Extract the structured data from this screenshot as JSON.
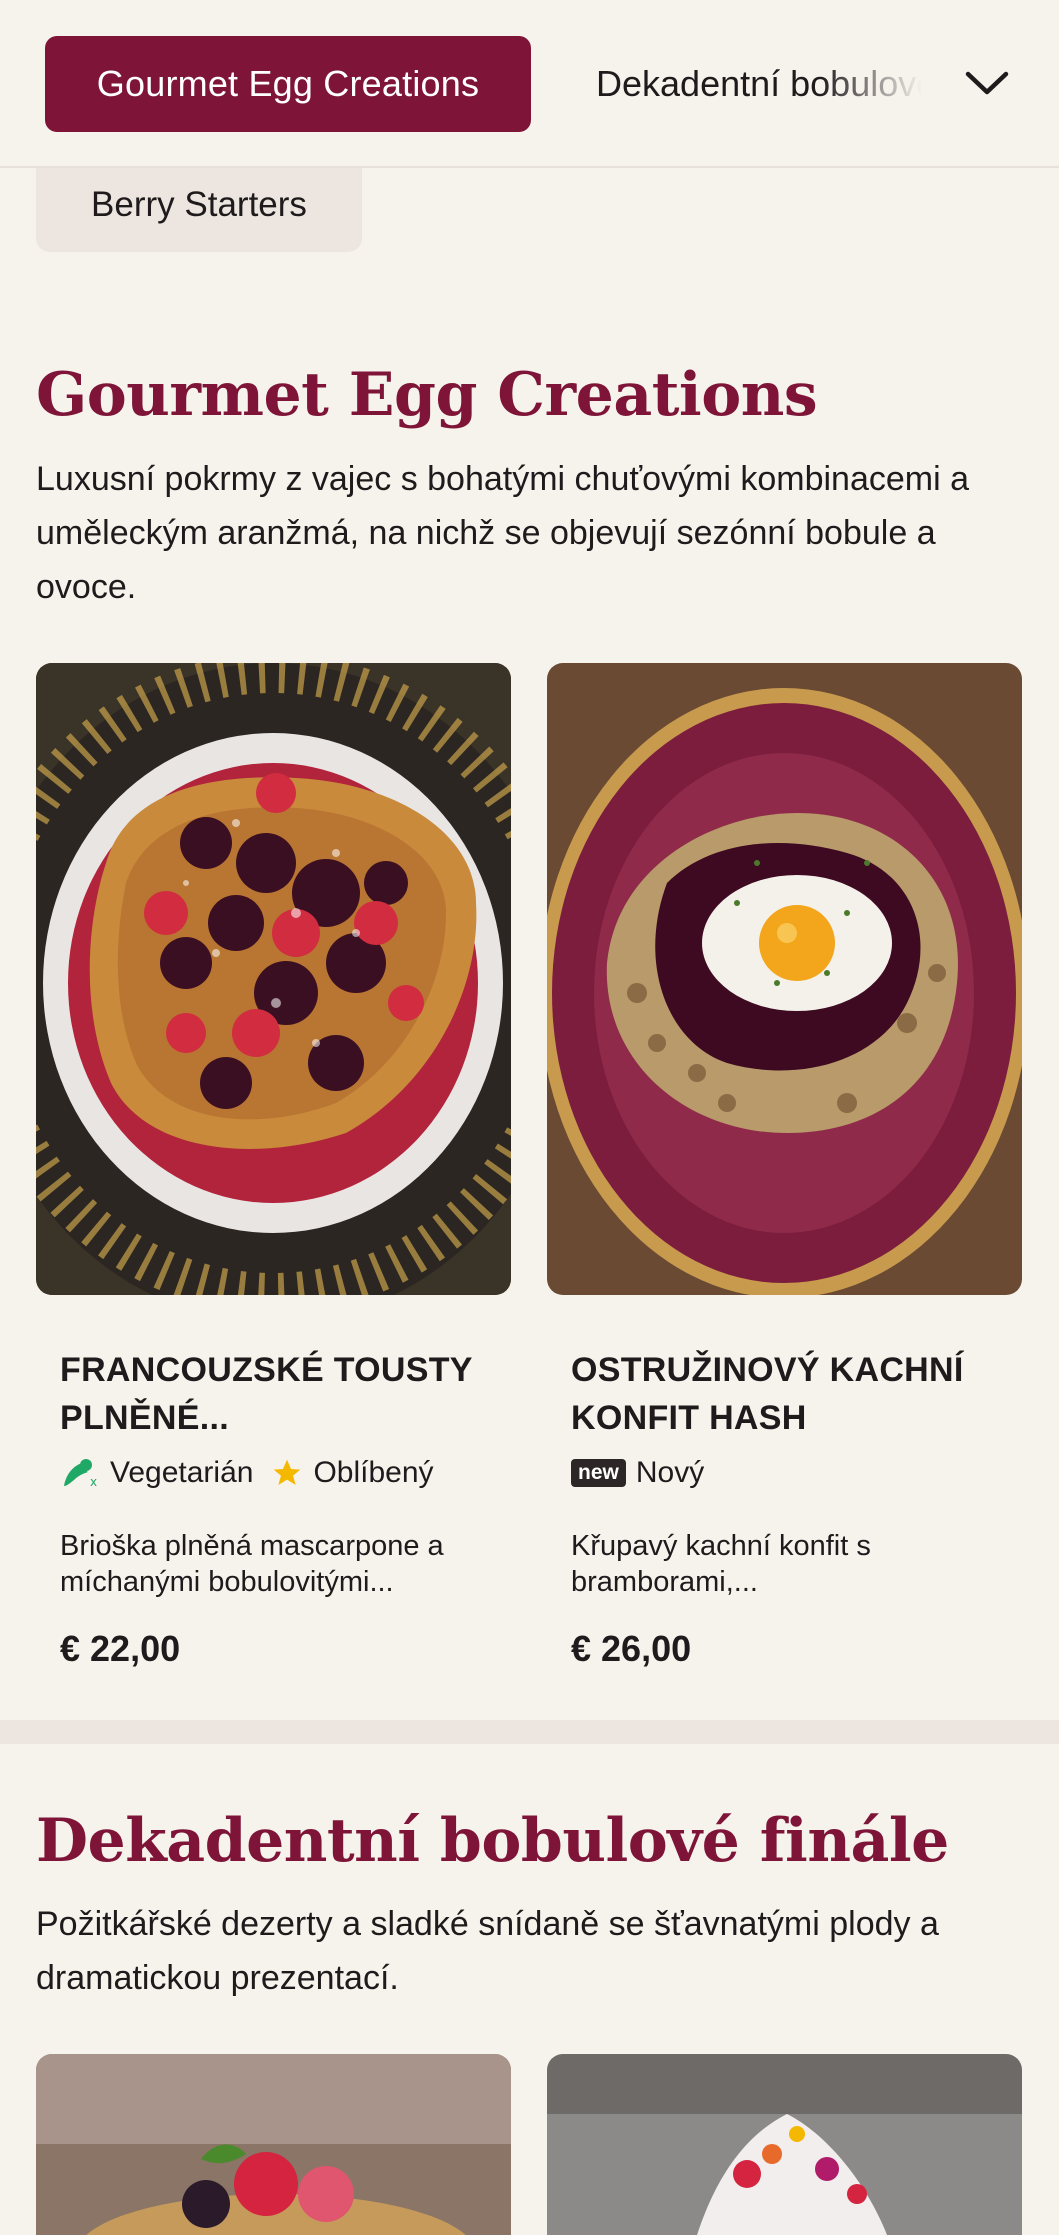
{
  "nav": {
    "active_category": "Gourmet Egg Creations",
    "next_category": "Dekadentní bobulové finále",
    "expand_icon": "chevron-down-icon",
    "previous_chip": "Berry Starters"
  },
  "colors": {
    "accent": "#7e1538",
    "background": "#f6f2ec"
  },
  "sections": [
    {
      "title": "Gourmet Egg Creations",
      "description": "Luxusní pokrmy z vajec s bohatými chuťovými kombinacemi a uměleckým aranžmá, na nichž se objevují sezónní bobule a ovoce.",
      "items": [
        {
          "title": "Francouzské tousty plněné...",
          "tags": [
            {
              "icon": "vegetarian-icon",
              "label": "Vegetarián"
            },
            {
              "icon": "star-icon",
              "label": "Oblíbený"
            }
          ],
          "description": "Brioška plněná mascarpone a míchanými bobulovitými...",
          "price": "€ 22,00"
        },
        {
          "title": "Ostružinový kachní konfit hash",
          "tags": [
            {
              "icon": "new-badge",
              "badge": "new",
              "label": "Nový"
            }
          ],
          "description": "Křupavý kachní konfit s bramborami,...",
          "price": "€ 26,00"
        }
      ]
    },
    {
      "title": "Dekadentní bobulové finále",
      "description": "Požitkářské dezerty a sladké snídaně se šťavnatými plody a dramatickou prezentací."
    }
  ]
}
